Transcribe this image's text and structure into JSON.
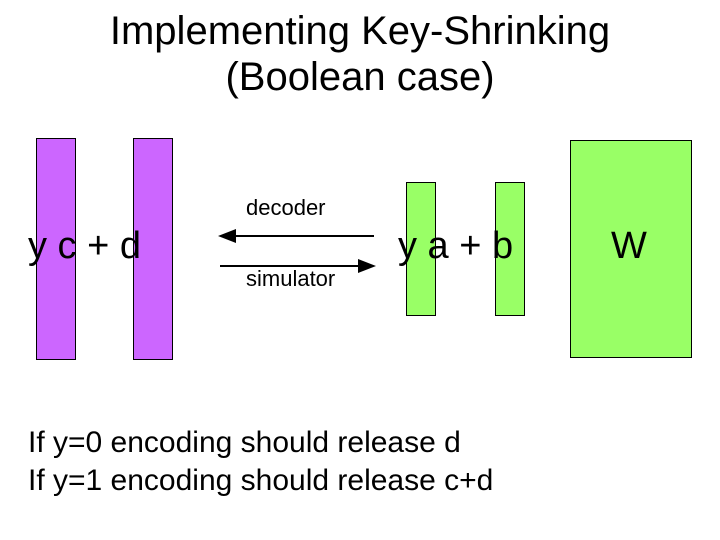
{
  "title": {
    "line1": "Implementing Key-Shrinking",
    "line2": "(Boolean case)"
  },
  "left_group": {
    "expression": "y c + d"
  },
  "right_group": {
    "expression": "y a + b"
  },
  "right_box": {
    "label": "W"
  },
  "arrows": {
    "top_label": "decoder",
    "bottom_label": "simulator"
  },
  "bottom": {
    "line1": "If y=0 encoding should release d",
    "line2": "If y=1 encoding should release c+d"
  },
  "colors": {
    "purple": "#cc66ff",
    "green": "#99ff66"
  }
}
